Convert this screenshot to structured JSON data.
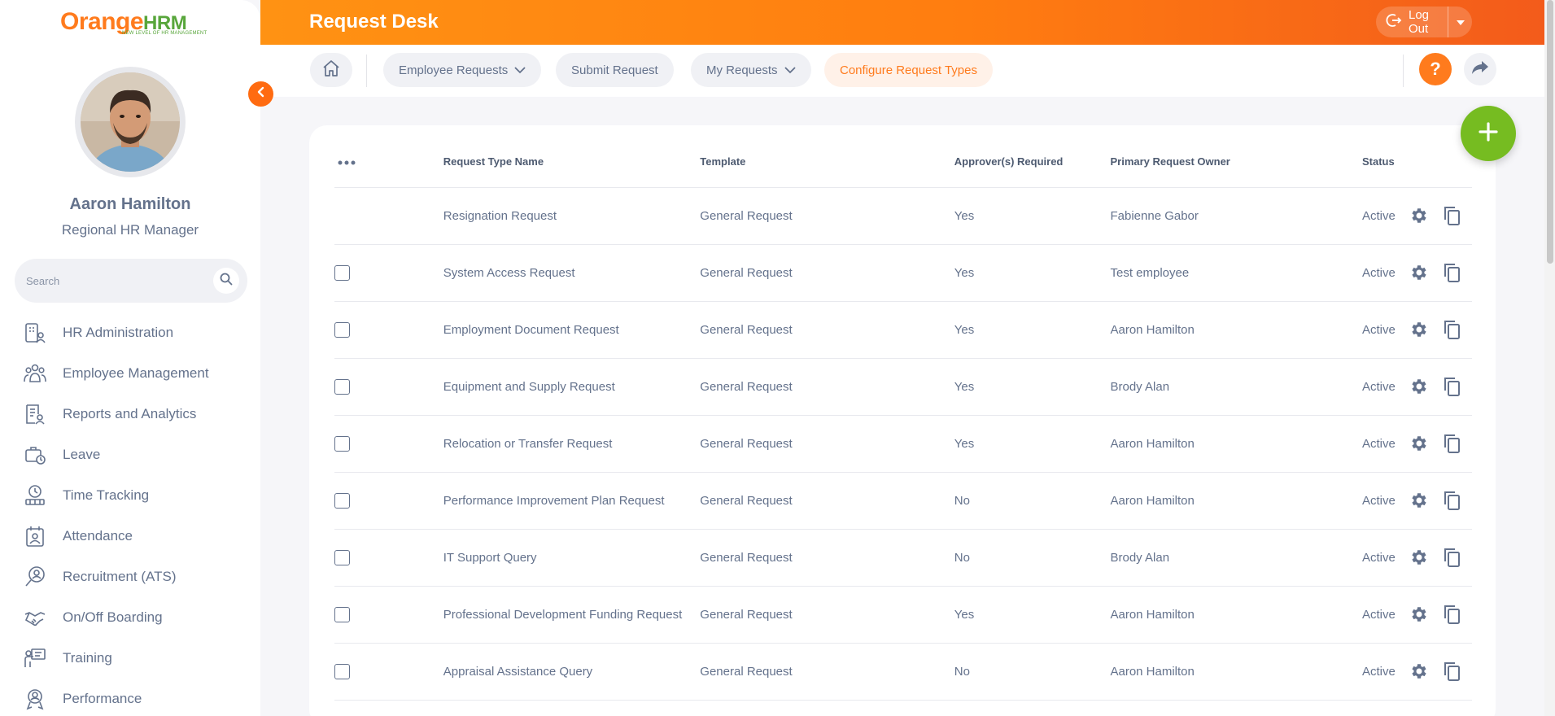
{
  "app": {
    "logo_primary": "Orange",
    "logo_secondary": "HRM",
    "logo_tagline": "NEW LEVEL OF HR MANAGEMENT"
  },
  "user": {
    "name": "Aaron Hamilton",
    "role": "Regional HR Manager"
  },
  "sidebar": {
    "search_placeholder": "Search",
    "items": [
      {
        "label": "HR Administration",
        "icon": "hr-administration-icon"
      },
      {
        "label": "Employee Management",
        "icon": "employee-management-icon"
      },
      {
        "label": "Reports and Analytics",
        "icon": "reports-icon"
      },
      {
        "label": "Leave",
        "icon": "leave-icon"
      },
      {
        "label": "Time Tracking",
        "icon": "time-tracking-icon"
      },
      {
        "label": "Attendance",
        "icon": "attendance-icon"
      },
      {
        "label": "Recruitment (ATS)",
        "icon": "recruitment-icon"
      },
      {
        "label": "On/Off Boarding",
        "icon": "onboarding-icon"
      },
      {
        "label": "Training",
        "icon": "training-icon"
      },
      {
        "label": "Performance",
        "icon": "performance-icon"
      }
    ]
  },
  "header": {
    "title": "Request Desk",
    "logout_label": "Log Out"
  },
  "nav": {
    "employee_requests": "Employee Requests",
    "submit_request": "Submit Request",
    "my_requests": "My Requests",
    "configure_request_types": "Configure Request Types"
  },
  "table": {
    "columns": [
      "Request Type Name",
      "Template",
      "Approver(s) Required",
      "Primary Request Owner",
      "Status"
    ],
    "rows": [
      {
        "name": "Resignation Request",
        "template": "General Request",
        "approver": "Yes",
        "owner": "Fabienne Gabor",
        "status": "Active",
        "checkbox": false
      },
      {
        "name": "System Access Request",
        "template": "General Request",
        "approver": "Yes",
        "owner": "Test employee",
        "status": "Active",
        "checkbox": true
      },
      {
        "name": "Employment Document Request",
        "template": "General Request",
        "approver": "Yes",
        "owner": "Aaron Hamilton",
        "status": "Active",
        "checkbox": true
      },
      {
        "name": "Equipment and Supply Request",
        "template": "General Request",
        "approver": "Yes",
        "owner": "Brody Alan",
        "status": "Active",
        "checkbox": true
      },
      {
        "name": "Relocation or Transfer Request",
        "template": "General Request",
        "approver": "Yes",
        "owner": "Aaron Hamilton",
        "status": "Active",
        "checkbox": true
      },
      {
        "name": "Performance Improvement Plan Request",
        "template": "General Request",
        "approver": "No",
        "owner": "Aaron Hamilton",
        "status": "Active",
        "checkbox": true
      },
      {
        "name": "IT Support Query",
        "template": "General Request",
        "approver": "No",
        "owner": "Brody Alan",
        "status": "Active",
        "checkbox": true
      },
      {
        "name": "Professional Development Funding Request",
        "template": "General Request",
        "approver": "Yes",
        "owner": "Aaron Hamilton",
        "status": "Active",
        "checkbox": true
      },
      {
        "name": "Appraisal Assistance Query",
        "template": "General Request",
        "approver": "No",
        "owner": "Aaron Hamilton",
        "status": "Active",
        "checkbox": true
      }
    ]
  },
  "colors": {
    "accent": "#ff7b1d",
    "fab": "#76bc21",
    "text": "#64728c"
  }
}
